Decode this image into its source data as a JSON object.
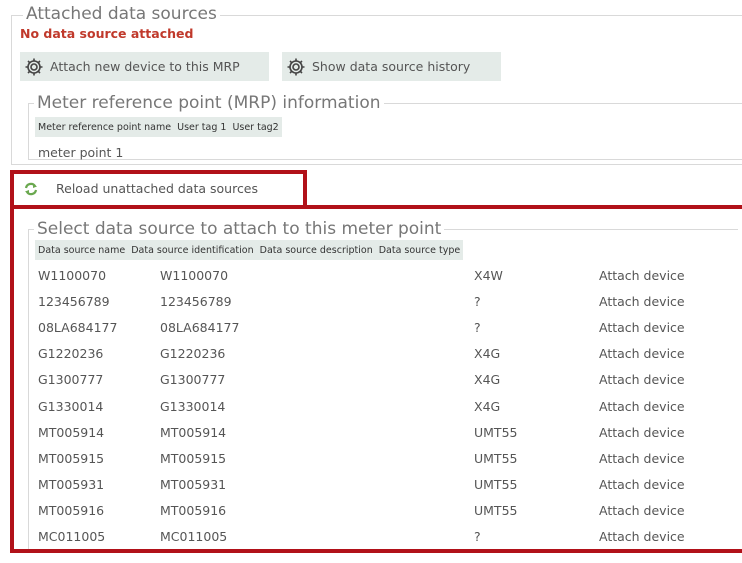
{
  "attached": {
    "legend": "Attached data sources",
    "status": "No data source attached",
    "attach_button": "Attach new device to this MRP",
    "history_button": "Show data source history"
  },
  "mrp": {
    "legend": "Meter reference point (MRP) information",
    "headers": [
      "Meter reference point name",
      "User tag 1",
      "User tag2"
    ],
    "name_value": "meter point 1"
  },
  "reload_label": "Reload unattached data sources",
  "select": {
    "legend": "Select data source to attach to this meter point",
    "headers": [
      "Data source name",
      "Data source identification",
      "Data source description",
      "Data source type"
    ],
    "rows": [
      {
        "name": "W1100070",
        "id": "W1100070",
        "description": "",
        "type": "X4W",
        "action": "Attach device"
      },
      {
        "name": "123456789",
        "id": "123456789",
        "description": "",
        "type": "?",
        "action": "Attach device"
      },
      {
        "name": "08LA684177",
        "id": "08LA684177",
        "description": "",
        "type": "?",
        "action": "Attach device"
      },
      {
        "name": "G1220236",
        "id": "G1220236",
        "description": "",
        "type": "X4G",
        "action": "Attach device"
      },
      {
        "name": "G1300777",
        "id": "G1300777",
        "description": "",
        "type": "X4G",
        "action": "Attach device"
      },
      {
        "name": "G1330014",
        "id": "G1330014",
        "description": "",
        "type": "X4G",
        "action": "Attach device"
      },
      {
        "name": "MT005914",
        "id": "MT005914",
        "description": "",
        "type": "UMT55",
        "action": "Attach device"
      },
      {
        "name": "MT005915",
        "id": "MT005915",
        "description": "",
        "type": "UMT55",
        "action": "Attach device"
      },
      {
        "name": "MT005931",
        "id": "MT005931",
        "description": "",
        "type": "UMT55",
        "action": "Attach device"
      },
      {
        "name": "MT005916",
        "id": "MT005916",
        "description": "",
        "type": "UMT55",
        "action": "Attach device"
      },
      {
        "name": "MC011005",
        "id": "MC011005",
        "description": "",
        "type": "?",
        "action": "Attach device"
      }
    ]
  },
  "colors": {
    "highlight": "#b11119",
    "warning": "#c0392b",
    "header_bg": "#e4ebe8"
  }
}
